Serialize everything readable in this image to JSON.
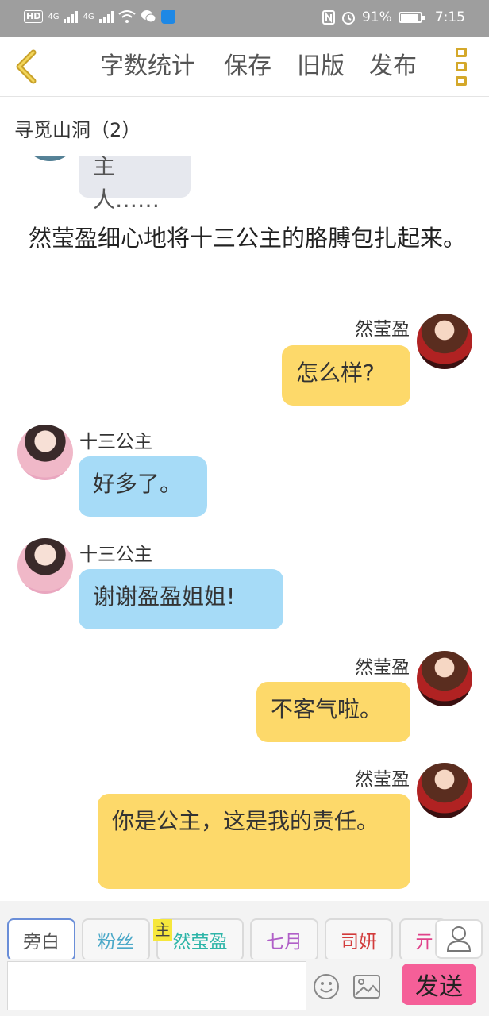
{
  "status_bar": {
    "hd_label": "HD",
    "network_1": "4G",
    "network_2": "4G",
    "battery": "91%",
    "time": "7:15"
  },
  "nav": {
    "word_count": "字数统计",
    "save": "保存",
    "old_version": "旧版",
    "publish": "发布"
  },
  "chapter_title": "寻觅山洞（2）",
  "messages": [
    {
      "type": "bubble",
      "side": "left",
      "text": "主人……"
    },
    {
      "type": "narration",
      "text": "然莹盈细心地将十三公主的胳膊包扎起来。"
    },
    {
      "type": "bubble",
      "side": "right",
      "speaker": "然莹盈",
      "text": "怎么样?"
    },
    {
      "type": "bubble",
      "side": "left",
      "speaker": "十三公主",
      "text": "好多了。"
    },
    {
      "type": "bubble",
      "side": "left",
      "speaker": "十三公主",
      "text": "谢谢盈盈姐姐!"
    },
    {
      "type": "bubble",
      "side": "right",
      "speaker": "然莹盈",
      "text": "不客气啦。"
    },
    {
      "type": "bubble",
      "side": "right",
      "speaker": "然莹盈",
      "text": "你是公主，这是我的责任。"
    }
  ],
  "characters": [
    {
      "label": "旁白",
      "color": "#555555",
      "selected": true
    },
    {
      "label": "粉丝",
      "color": "#4aa8c8"
    },
    {
      "label": "然莹盈",
      "color": "#2db5a8",
      "tag": "主"
    },
    {
      "label": "七月",
      "color": "#b05fc8"
    },
    {
      "label": "司妍",
      "color": "#d23b3b"
    },
    {
      "label": "亓",
      "color": "#e0428a"
    }
  ],
  "input": {
    "placeholder": "",
    "value": ""
  },
  "send_label": "发送",
  "colors": {
    "left_bubble": "#a6dbf7",
    "right_bubble": "#fdd96a",
    "send_button": "#f55f98",
    "nav_icon": "#d4a82a"
  }
}
